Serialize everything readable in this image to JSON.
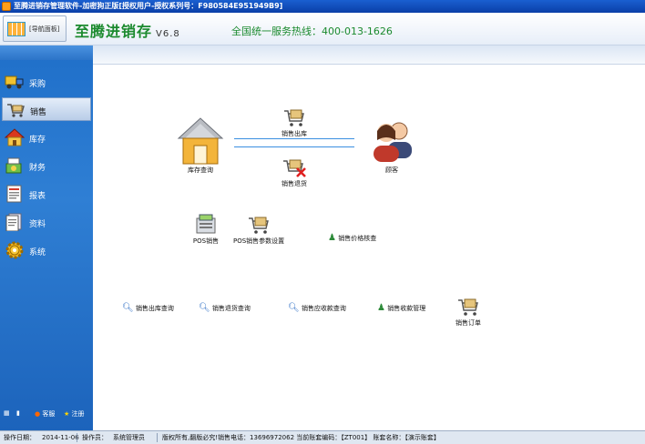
{
  "window": {
    "title": "至腾进销存管理软件-加密狗正版[授权用户-授权系列号：F980584E951949B9]"
  },
  "header": {
    "nav_panel_label": "[导航面板]",
    "brand": "至腾进销存",
    "version": "V6.8",
    "hotline": "全国统一服务热线：400-013-1626"
  },
  "sidebar": {
    "items": [
      {
        "label": "采购",
        "icon": "truck-icon"
      },
      {
        "label": "销售",
        "icon": "cart-icon",
        "active": true
      },
      {
        "label": "库存",
        "icon": "house-icon"
      },
      {
        "label": "财务",
        "icon": "money-icon"
      },
      {
        "label": "报表",
        "icon": "report-icon"
      },
      {
        "label": "资料",
        "icon": "document-icon"
      },
      {
        "label": "系统",
        "icon": "gear-icon"
      }
    ],
    "bottom": {
      "help": "客服",
      "register": "注册"
    }
  },
  "main": {
    "inventory_query": "库存查询",
    "sales_out": "销售出库",
    "sales_return": "销售退货",
    "customer": "顾客",
    "pos_sales": "POS销售",
    "pos_settings": "POS销售参数设置",
    "price_check": "销售价格核查",
    "sales_out_query": "销售出库查询",
    "sales_return_query": "销售退货查询",
    "receivable_query": "销售应收款查询",
    "collection_mgmt": "销售收款管理",
    "sales_order": "销售订单"
  },
  "status": {
    "date_label": "操作日期：",
    "date": "2014-11-06",
    "operator_label": "操作员：",
    "operator": "系统管理员",
    "info": "版权所有,翻版必究!销售电话：13696972062  当前账套编码：【ZT001】  账套名称：【演示账套】"
  },
  "colors": {
    "accent_green": "#1b8a2e",
    "sidebar_blue": "#2c74c8",
    "arrow_blue": "#3a8fe0"
  }
}
